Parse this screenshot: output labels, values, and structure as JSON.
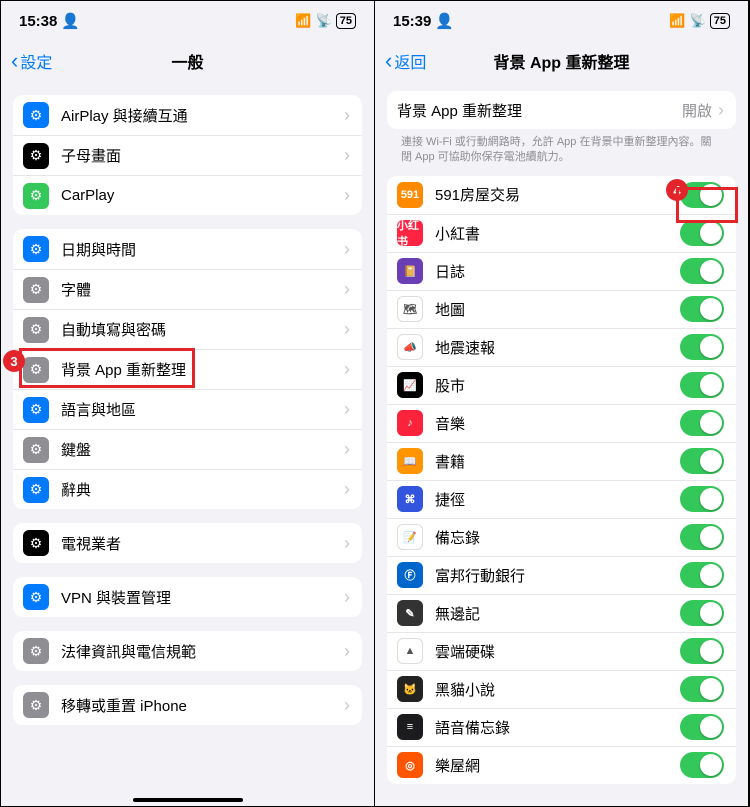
{
  "left": {
    "status": {
      "time": "15:38",
      "battery": "75"
    },
    "nav": {
      "back": "設定",
      "title": "一般"
    },
    "groups": [
      [
        {
          "icon": "airplay-icon",
          "ic": "ic-blue",
          "label": "AirPlay 與接續互通"
        },
        {
          "icon": "pip-icon",
          "ic": "ic-black",
          "label": "子母畫面"
        },
        {
          "icon": "carplay-icon",
          "ic": "ic-green",
          "label": "CarPlay"
        }
      ],
      [
        {
          "icon": "calendar-icon",
          "ic": "ic-blue",
          "label": "日期與時間"
        },
        {
          "icon": "font-icon",
          "ic": "ic-gray",
          "label": "字體"
        },
        {
          "icon": "autofill-icon",
          "ic": "ic-gray",
          "label": "自動填寫與密碼"
        },
        {
          "icon": "refresh-icon",
          "ic": "ic-gray",
          "label": "背景 App 重新整理"
        },
        {
          "icon": "lang-icon",
          "ic": "ic-blue",
          "label": "語言與地區"
        },
        {
          "icon": "keyboard-icon",
          "ic": "ic-gray",
          "label": "鍵盤"
        },
        {
          "icon": "dict-icon",
          "ic": "ic-blue",
          "label": "辭典"
        }
      ],
      [
        {
          "icon": "tv-icon",
          "ic": "ic-black",
          "label": "電視業者"
        }
      ],
      [
        {
          "icon": "vpn-icon",
          "ic": "ic-blue",
          "label": "VPN 與裝置管理"
        }
      ],
      [
        {
          "icon": "legal-icon",
          "ic": "ic-gray",
          "label": "法律資訊與電信規範"
        }
      ],
      [
        {
          "icon": "transfer-icon",
          "ic": "ic-gray",
          "label": "移轉或重置 iPhone"
        }
      ]
    ],
    "annotation": {
      "number": "3"
    }
  },
  "right": {
    "status": {
      "time": "15:39",
      "battery": "75"
    },
    "nav": {
      "back": "返回",
      "title": "背景 App 重新整理"
    },
    "master": {
      "label": "背景 App 重新整理",
      "value": "開啟"
    },
    "note": "連接 Wi-Fi 或行動網路時，允許 App 在背景中重新整理內容。關閉 App 可協助你保存電池續航力。",
    "apps": [
      {
        "name": "591房屋交易",
        "icon_bg": "#ff8a00",
        "icon_txt": "591"
      },
      {
        "name": "小紅書",
        "icon_bg": "#ff2442",
        "icon_txt": "小红书"
      },
      {
        "name": "日誌",
        "icon_bg": "#6a3fb5",
        "icon_txt": "📔"
      },
      {
        "name": "地圖",
        "icon_bg": "#ffffff",
        "icon_txt": "🗺"
      },
      {
        "name": "地震速報",
        "icon_bg": "#ffffff",
        "icon_txt": "📣"
      },
      {
        "name": "股市",
        "icon_bg": "#000000",
        "icon_txt": "📈"
      },
      {
        "name": "音樂",
        "icon_bg": "#fa233b",
        "icon_txt": "♪"
      },
      {
        "name": "書籍",
        "icon_bg": "#ff9500",
        "icon_txt": "📖"
      },
      {
        "name": "捷徑",
        "icon_bg": "#3355dd",
        "icon_txt": "⌘"
      },
      {
        "name": "備忘錄",
        "icon_bg": "#ffffff",
        "icon_txt": "📝"
      },
      {
        "name": "富邦行動銀行",
        "icon_bg": "#0066cc",
        "icon_txt": "Ⓕ"
      },
      {
        "name": "無邊記",
        "icon_bg": "#333333",
        "icon_txt": "✎"
      },
      {
        "name": "雲端硬碟",
        "icon_bg": "#ffffff",
        "icon_txt": "▲"
      },
      {
        "name": "黑貓小說",
        "icon_bg": "#222222",
        "icon_txt": "🐱"
      },
      {
        "name": "語音備忘錄",
        "icon_bg": "#1c1c1e",
        "icon_txt": "≡"
      },
      {
        "name": "樂屋網",
        "icon_bg": "#ff5500",
        "icon_txt": "◎"
      }
    ],
    "annotation": {
      "number": "4"
    }
  }
}
